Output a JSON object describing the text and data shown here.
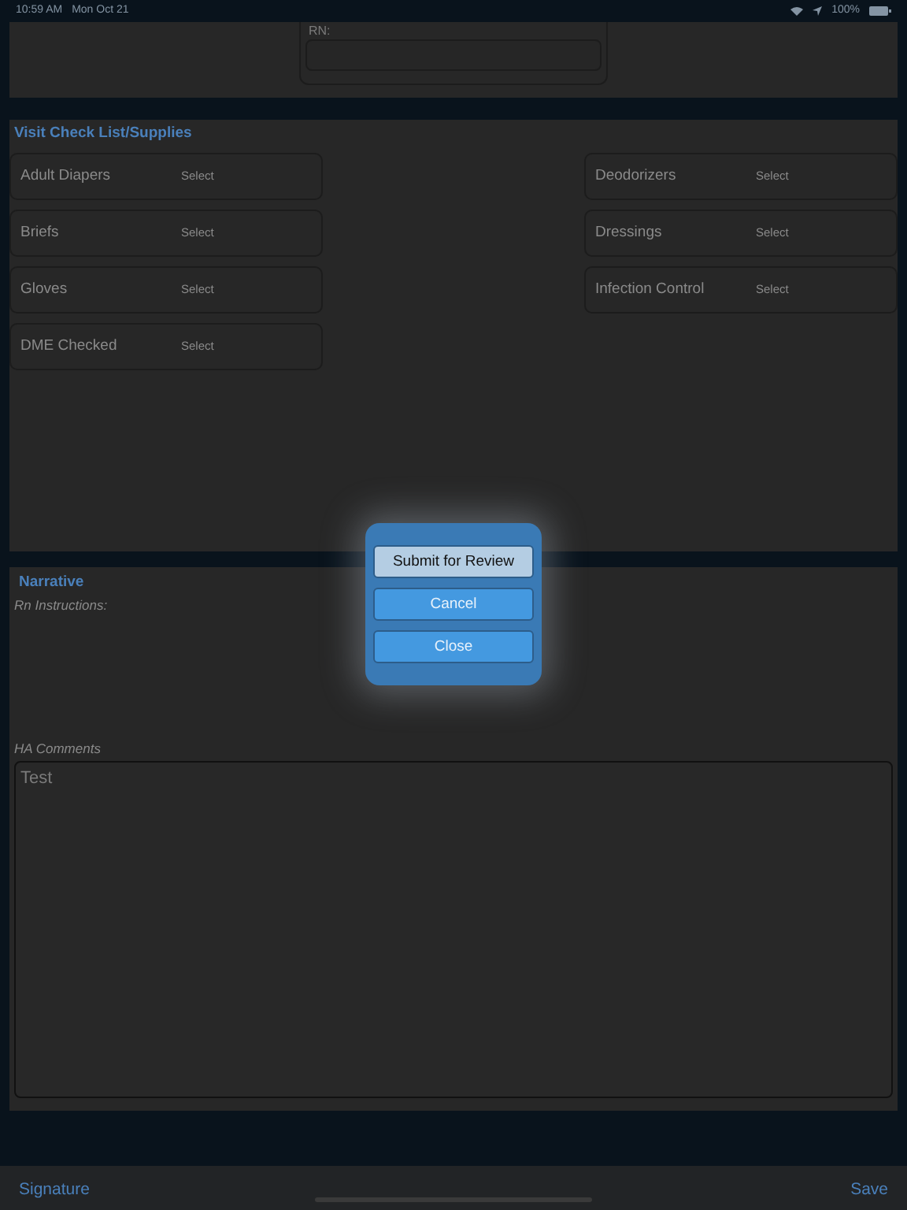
{
  "status_bar": {
    "time": "10:59 AM",
    "date": "Mon Oct 21",
    "battery": "100%"
  },
  "rn_field": {
    "label": "RN:"
  },
  "checklist": {
    "title": "Visit Check List/Supplies",
    "left": [
      {
        "label": "Adult Diapers",
        "value": "Select"
      },
      {
        "label": "Briefs",
        "value": "Select"
      },
      {
        "label": "Gloves",
        "value": "Select"
      },
      {
        "label": "DME Checked",
        "value": "Select"
      }
    ],
    "right": [
      {
        "label": "Deodorizers",
        "value": "Select"
      },
      {
        "label": "Dressings",
        "value": "Select"
      },
      {
        "label": "Infection Control",
        "value": "Select"
      }
    ]
  },
  "narrative": {
    "title": "Narrative",
    "rn_instructions_label": "Rn Instructions:",
    "ha_comments_label": "HA Comments",
    "ha_comments_value": "Test"
  },
  "dialog": {
    "buttons": [
      {
        "label": "Submit for Review",
        "selected": true
      },
      {
        "label": "Cancel",
        "selected": false
      },
      {
        "label": "Close",
        "selected": false
      }
    ]
  },
  "toolbar": {
    "left": "Signature",
    "right": "Save"
  }
}
